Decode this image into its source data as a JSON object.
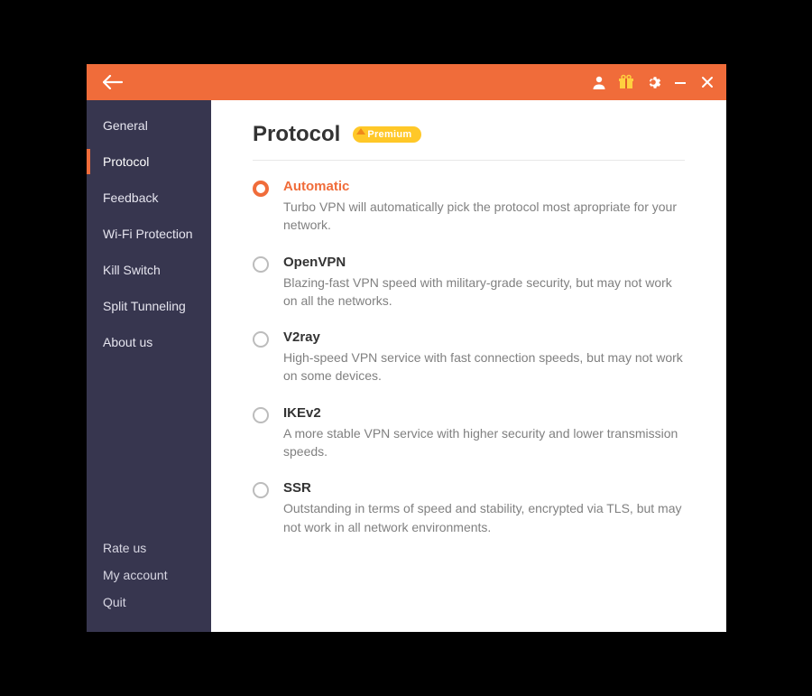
{
  "titlebar": {
    "back_aria": "Back"
  },
  "sidebar": {
    "items": [
      {
        "label": "General"
      },
      {
        "label": "Protocol"
      },
      {
        "label": "Feedback"
      },
      {
        "label": "Wi-Fi Protection"
      },
      {
        "label": "Kill Switch"
      },
      {
        "label": "Split Tunneling"
      },
      {
        "label": "About us"
      }
    ],
    "active_index": 1,
    "bottom": [
      {
        "label": "Rate us"
      },
      {
        "label": "My account"
      },
      {
        "label": "Quit"
      }
    ]
  },
  "page": {
    "title": "Protocol",
    "premium_label": "Premium",
    "options": [
      {
        "title": "Automatic",
        "desc": "Turbo VPN will automatically pick the protocol most apropriate for your network."
      },
      {
        "title": "OpenVPN",
        "desc": "Blazing-fast VPN speed with military-grade security, but may not work on all the networks."
      },
      {
        "title": "V2ray",
        "desc": "High-speed VPN service with fast connection speeds, but may not work on some devices."
      },
      {
        "title": "IKEv2",
        "desc": "A more stable VPN service with higher security and lower transmission speeds."
      },
      {
        "title": "SSR",
        "desc": "Outstanding in terms of speed and stability, encrypted via TLS, but may not work in all network environments."
      }
    ],
    "selected_index": 0
  }
}
